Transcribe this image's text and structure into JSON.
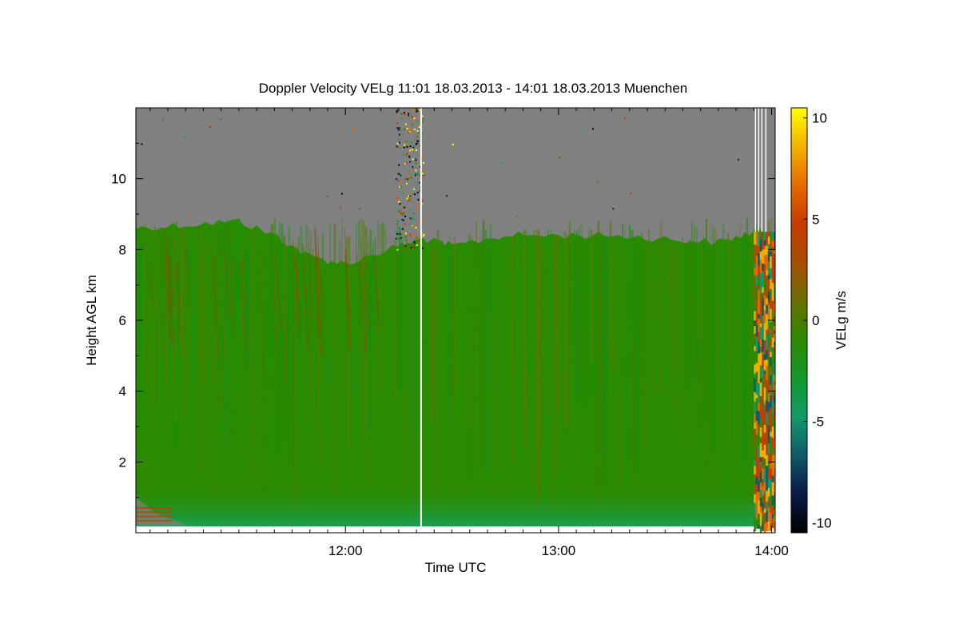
{
  "chart_data": {
    "type": "heatmap",
    "title": "Doppler Velocity VELg   11:01 18.03.2013 - 14:01 18.03.2013 Muenchen",
    "xlabel": "Time UTC",
    "ylabel": "Height AGL km",
    "x_range": [
      "11:01",
      "14:01"
    ],
    "x_ticks": [
      "12:00",
      "13:00",
      "14:00"
    ],
    "ylim": [
      0,
      12
    ],
    "y_ticks": [
      2,
      4,
      6,
      8,
      10
    ],
    "colorbar": {
      "label": "VELg m/s",
      "range": [
        -10.5,
        10.5
      ],
      "ticks": [
        10,
        5,
        0,
        -5,
        -10
      ]
    },
    "missing_color": "#808080",
    "colors": {
      "no_signal": "#808080",
      "dominant_velocity": "#2a8a00",
      "colorscale": [
        "#000000",
        "#0a1a4a",
        "#0e5a6a",
        "#139a6a",
        "#0f9a2a",
        "#2e8a00",
        "#6a7000",
        "#a84f00",
        "#c83a00",
        "#e86a00",
        "#f4b000",
        "#ffff00"
      ]
    },
    "cloud_top_km": [
      [
        "11:01",
        8.6
      ],
      [
        "11:15",
        8.7
      ],
      [
        "11:30",
        8.8
      ],
      [
        "11:40",
        8.4
      ],
      [
        "11:50",
        7.8
      ],
      [
        "12:00",
        7.6
      ],
      [
        "12:15",
        8.1
      ],
      [
        "12:22",
        8.3
      ],
      [
        "12:30",
        8.1
      ],
      [
        "12:45",
        8.4
      ],
      [
        "13:00",
        8.4
      ],
      [
        "13:15",
        8.4
      ],
      [
        "13:30",
        8.3
      ],
      [
        "13:45",
        8.2
      ],
      [
        "13:55",
        8.5
      ]
    ],
    "annotations": [
      "data gap near 12:21 UTC",
      "precipitation onset near 13:55 UTC with velocities up to about 5 m/s"
    ]
  }
}
